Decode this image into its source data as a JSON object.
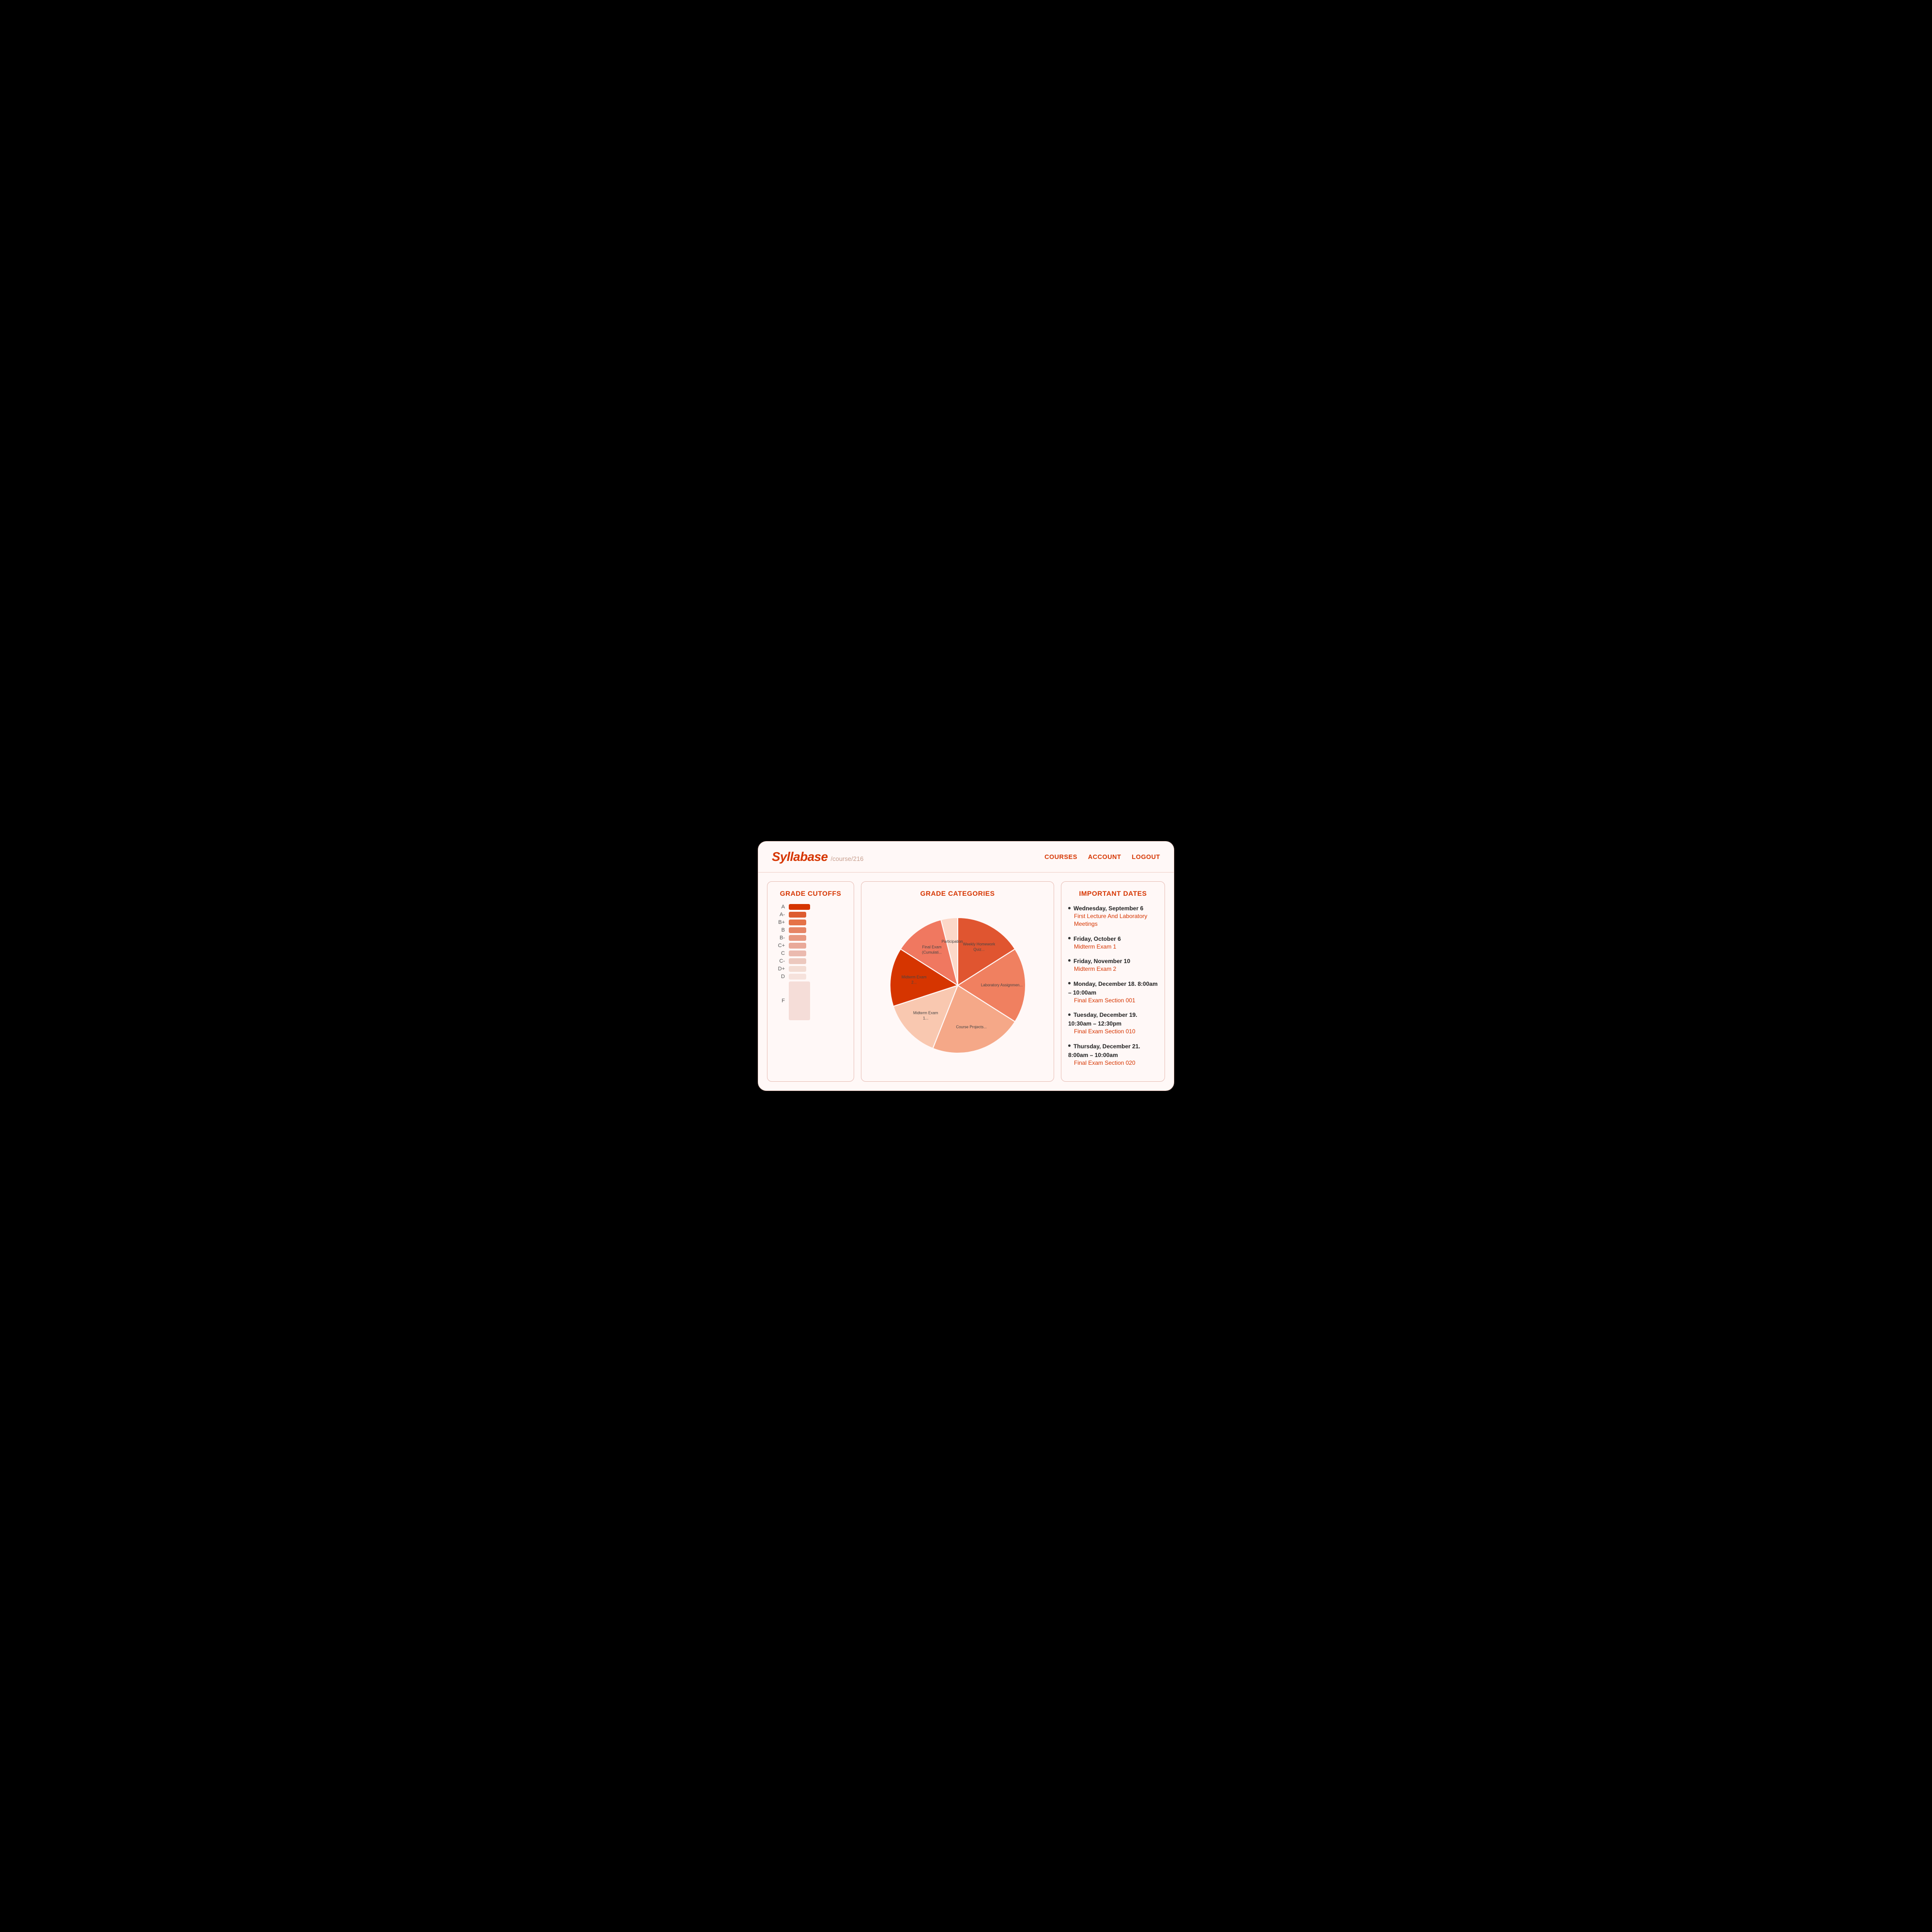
{
  "header": {
    "logo": "Syllabase",
    "path": "/course/216",
    "nav": [
      "COURSES",
      "ACCOUNT",
      "LOGOUT"
    ]
  },
  "grade_cutoffs": {
    "title": "GRADE CUTOFFS",
    "grades": [
      {
        "label": "A",
        "color": "#d63500",
        "width": 44,
        "opacity": 1.0
      },
      {
        "label": "A-",
        "color": "#d94a1a",
        "width": 36,
        "opacity": 0.9
      },
      {
        "label": "B+",
        "color": "#e05a28",
        "width": 36,
        "opacity": 0.85
      },
      {
        "label": "B",
        "color": "#e06840",
        "width": 36,
        "opacity": 0.8
      },
      {
        "label": "B-",
        "color": "#e07858",
        "width": 36,
        "opacity": 0.75
      },
      {
        "label": "C+",
        "color": "#e08870",
        "width": 36,
        "opacity": 0.7
      },
      {
        "label": "C",
        "color": "#e09888",
        "width": 36,
        "opacity": 0.65
      },
      {
        "label": "C-",
        "color": "#e0a898",
        "width": 36,
        "opacity": 0.6
      },
      {
        "label": "D+",
        "color": "#e8c0b0",
        "width": 36,
        "opacity": 0.5
      },
      {
        "label": "D",
        "color": "#ecc8ba",
        "width": 36,
        "opacity": 0.45
      },
      {
        "label": "F",
        "color": "#f5ddd8",
        "width": 44,
        "height": 80
      }
    ]
  },
  "grade_categories": {
    "title": "GRADE CATEGORIES",
    "slices": [
      {
        "label": "Weekly Homework Quiz...",
        "color": "#e05530",
        "percent": 16
      },
      {
        "label": "Laboratory Assignmen...",
        "color": "#f08060",
        "percent": 18
      },
      {
        "label": "Course Projects...",
        "color": "#f5a888",
        "percent": 22
      },
      {
        "label": "Midterm Exam 1...",
        "color": "#f9c8b0",
        "percent": 14
      },
      {
        "label": "Midterm Exam 2...",
        "color": "#d63500",
        "percent": 14
      },
      {
        "label": "Final Exam (Cumulati...",
        "color": "#f07860",
        "percent": 12
      },
      {
        "label": "Participation",
        "color": "#fcd8c8",
        "percent": 4
      }
    ]
  },
  "important_dates": {
    "title": "IMPORTANT DATES",
    "dates": [
      {
        "day": "Wednesday, September 6",
        "link": "First Lecture And Laboratory Meetings"
      },
      {
        "day": "Friday, October 6",
        "link": "Midterm Exam 1"
      },
      {
        "day": "Friday, November 10",
        "link": "Midterm Exam 2"
      },
      {
        "day": "Monday, December 18. 8:00am – 10:00am",
        "link": "Final Exam Section 001"
      },
      {
        "day": "Tuesday, December 19. 10:30am – 12:30pm",
        "link": "Final Exam Section 010"
      },
      {
        "day": "Thursday, December 21. 8:00am – 10:00am",
        "link": "Final Exam Section 020"
      }
    ]
  }
}
